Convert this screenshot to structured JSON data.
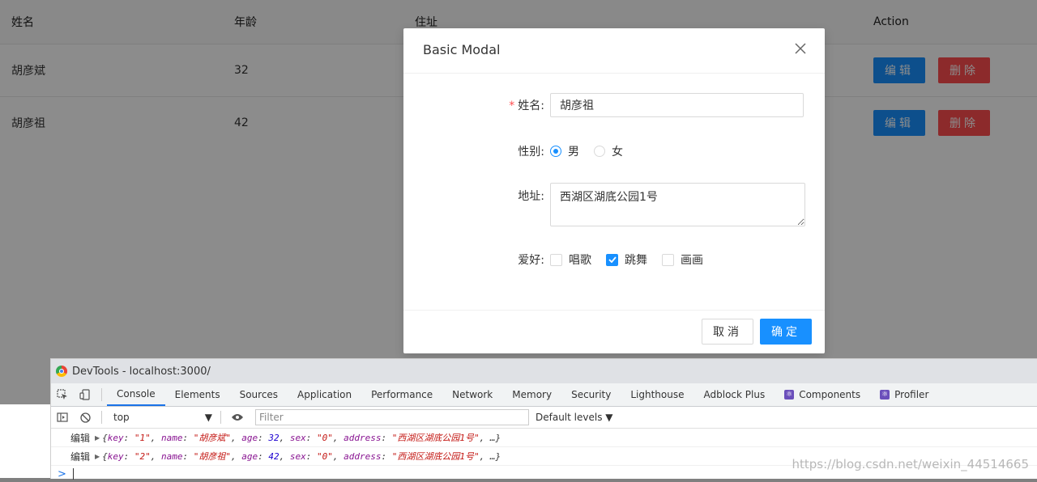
{
  "table": {
    "headers": {
      "name": "姓名",
      "age": "年龄",
      "address": "住址",
      "action": "Action"
    },
    "rows": [
      {
        "name": "胡彦斌",
        "age": "32",
        "edit": "编辑",
        "delete": "删除"
      },
      {
        "name": "胡彦祖",
        "age": "42",
        "edit": "编辑",
        "delete": "删除"
      }
    ]
  },
  "modal": {
    "title": "Basic Modal",
    "close_icon": "close-icon",
    "fields": {
      "name": {
        "label": "姓名:",
        "required": "*",
        "value": "胡彦祖"
      },
      "sex": {
        "label": "性别:",
        "options": [
          "男",
          "女"
        ],
        "selected": "男"
      },
      "address": {
        "label": "地址:",
        "value": "西湖区湖底公园1号"
      },
      "hobby": {
        "label": "爱好:",
        "options": [
          "唱歌",
          "跳舞",
          "画画"
        ],
        "checked": [
          "跳舞"
        ]
      }
    },
    "cancel": "取消",
    "ok": "确定"
  },
  "devtools": {
    "title": "DevTools - localhost:3000/",
    "tabs": [
      "Console",
      "Elements",
      "Sources",
      "Application",
      "Performance",
      "Network",
      "Memory",
      "Security",
      "Lighthouse",
      "Adblock Plus",
      "Components",
      "Profiler"
    ],
    "active_tab": "Console",
    "context": "top",
    "filter_placeholder": "Filter",
    "levels": "Default levels",
    "logs": [
      {
        "label": "编辑",
        "key": "\"1\"",
        "name": "\"胡彦斌\"",
        "age": "32",
        "sex": "\"0\"",
        "address": "\"西湖区湖底公园1号\""
      },
      {
        "label": "编辑",
        "key": "\"2\"",
        "name": "\"胡彦祖\"",
        "age": "42",
        "sex": "\"0\"",
        "address": "\"西湖区湖底公园1号\""
      }
    ],
    "prompt": ">"
  },
  "watermark": "https://blog.csdn.net/weixin_44514665",
  "colors": {
    "primary": "#1890ff",
    "danger": "#ff4d4f",
    "mask": "rgba(0,0,0,0.45)"
  }
}
